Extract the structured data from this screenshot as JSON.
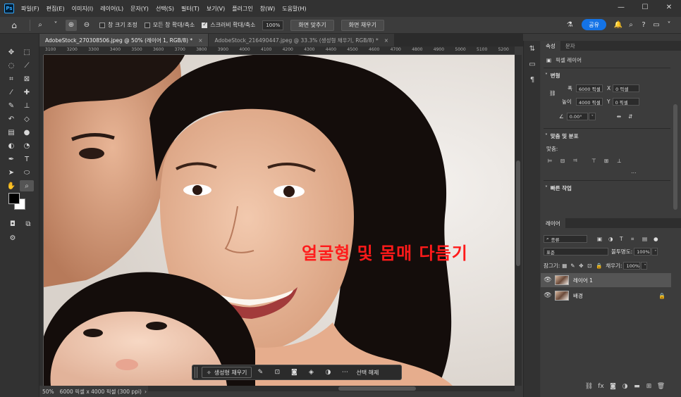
{
  "app": {
    "logo": "Ps"
  },
  "menu": [
    "파일(F)",
    "편집(E)",
    "이미지(I)",
    "레이어(L)",
    "문자(Y)",
    "선택(S)",
    "필터(T)",
    "보기(V)",
    "플러그인",
    "창(W)",
    "도움말(H)"
  ],
  "options": {
    "resize_windows": "창 크기 조정",
    "zoom_all": "모든 창 확대/축소",
    "scrubby_zoom": "스크러비 확대/축소",
    "zoom_value": "100%",
    "fit_screen": "화면 맞추기",
    "fill_screen": "화면 채우기",
    "share": "공유"
  },
  "tabs": [
    {
      "label": "AdobeStock_270308506.jpeg @ 50% (레이어 1, RGB/8) *",
      "close": "×"
    },
    {
      "label": "AdobeStock_216490447.jpeg @ 33.3% (생성형 채우기, RGB/8) *",
      "close": "×"
    }
  ],
  "ruler_ticks": [
    "3100",
    "3200",
    "3300",
    "3400",
    "3500",
    "3600",
    "3700",
    "3800",
    "3900",
    "4000",
    "4100",
    "4200",
    "4300",
    "4400",
    "4500",
    "4600",
    "4700",
    "4800",
    "4900",
    "5000",
    "5100",
    "5200"
  ],
  "canvas": {
    "overlay_text": "얼굴형 및 몸매 다듬기"
  },
  "contextual_bar": {
    "generative_fill": "생성형 채우기",
    "deselect": "선택 해제"
  },
  "status": {
    "zoom": "50%",
    "doc_size": "6000 픽셀 x 4000 픽셀 (300 ppi)"
  },
  "properties": {
    "tabs": [
      "속성",
      "문자"
    ],
    "layer_type": "픽셀 레이어",
    "transform_title": "변형",
    "w_label": "폭",
    "w_value": "6000 픽셀",
    "h_label": "높이",
    "h_value": "4000 픽셀",
    "x_label": "X",
    "x_value": "0 픽셀",
    "y_label": "Y",
    "y_value": "0 픽셀",
    "angle_value": "0.00°",
    "align_title": "맞춤 및 분포",
    "align_label": "맞춤:",
    "quick_title": "빠른 작업"
  },
  "layers": {
    "tab": "레이어",
    "filter": "종류",
    "blend_mode": "표준",
    "opacity_label": "불투명도:",
    "opacity_value": "100%",
    "lock_label": "잠그기:",
    "fill_label": "채우기:",
    "fill_value": "100%",
    "items": [
      {
        "name": "레이어 1",
        "selected": true
      },
      {
        "name": "배경",
        "selected": false,
        "locked": true
      }
    ]
  }
}
